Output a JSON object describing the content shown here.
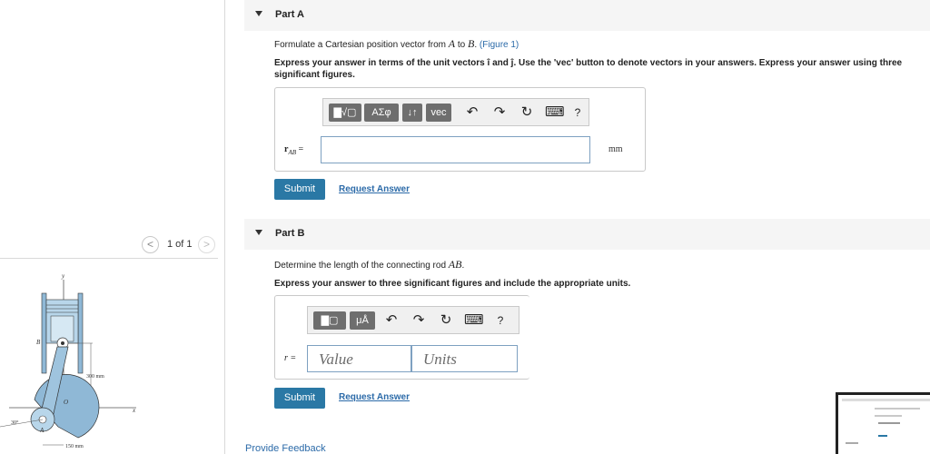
{
  "pager": {
    "prev": "<",
    "text": "1 of 1",
    "next": ">"
  },
  "figure": {
    "labels": {
      "y_axis": "y",
      "x_axis": "x",
      "point_b": "B",
      "point_a": "A",
      "point_o": "O",
      "dim_vertical": "300 mm",
      "dim_horizontal": "150 mm",
      "angle": "30°"
    }
  },
  "partA": {
    "title": "Part A",
    "prompt_prefix": "Formulate a Cartesian position vector from ",
    "prompt_A": "A",
    "prompt_to": " to ",
    "prompt_B": "B",
    "prompt_period": ". ",
    "figure_link": "(Figure 1)",
    "instruction_prefix": "Express your answer in terms of the unit vectors ",
    "unit_i": "î",
    "and": " and ",
    "unit_j": "ĵ",
    "instruction_suffix": ". Use the 'vec' button to denote vectors in your answers. Express your answer using three",
    "instruction_line2": "significant figures.",
    "toolbar": {
      "template": "▇√▢",
      "greek": "ΑΣφ",
      "arrows": "↓↑",
      "vec": "vec",
      "undo": "↶",
      "redo": "↷",
      "reset": "↻",
      "keyboard": "⌨",
      "help": "?"
    },
    "answer_label": "r",
    "answer_sub": "AB",
    "answer_eq": " =",
    "unit": "mm",
    "submit": "Submit",
    "request": "Request Answer"
  },
  "partB": {
    "title": "Part B",
    "prompt_prefix": "Determine the length of the connecting rod ",
    "prompt_AB": "AB",
    "prompt_period": ".",
    "instruction": "Express your answer to three significant figures and include the appropriate units.",
    "toolbar": {
      "template": "▇▢",
      "mu": "μÅ",
      "undo": "↶",
      "redo": "↷",
      "reset": "↻",
      "keyboard": "⌨",
      "help": "?"
    },
    "answer_label": "r =",
    "value_placeholder": "Value",
    "units_placeholder": "Units",
    "submit": "Submit",
    "request": "Request Answer"
  },
  "feedback": "Provide Feedback"
}
